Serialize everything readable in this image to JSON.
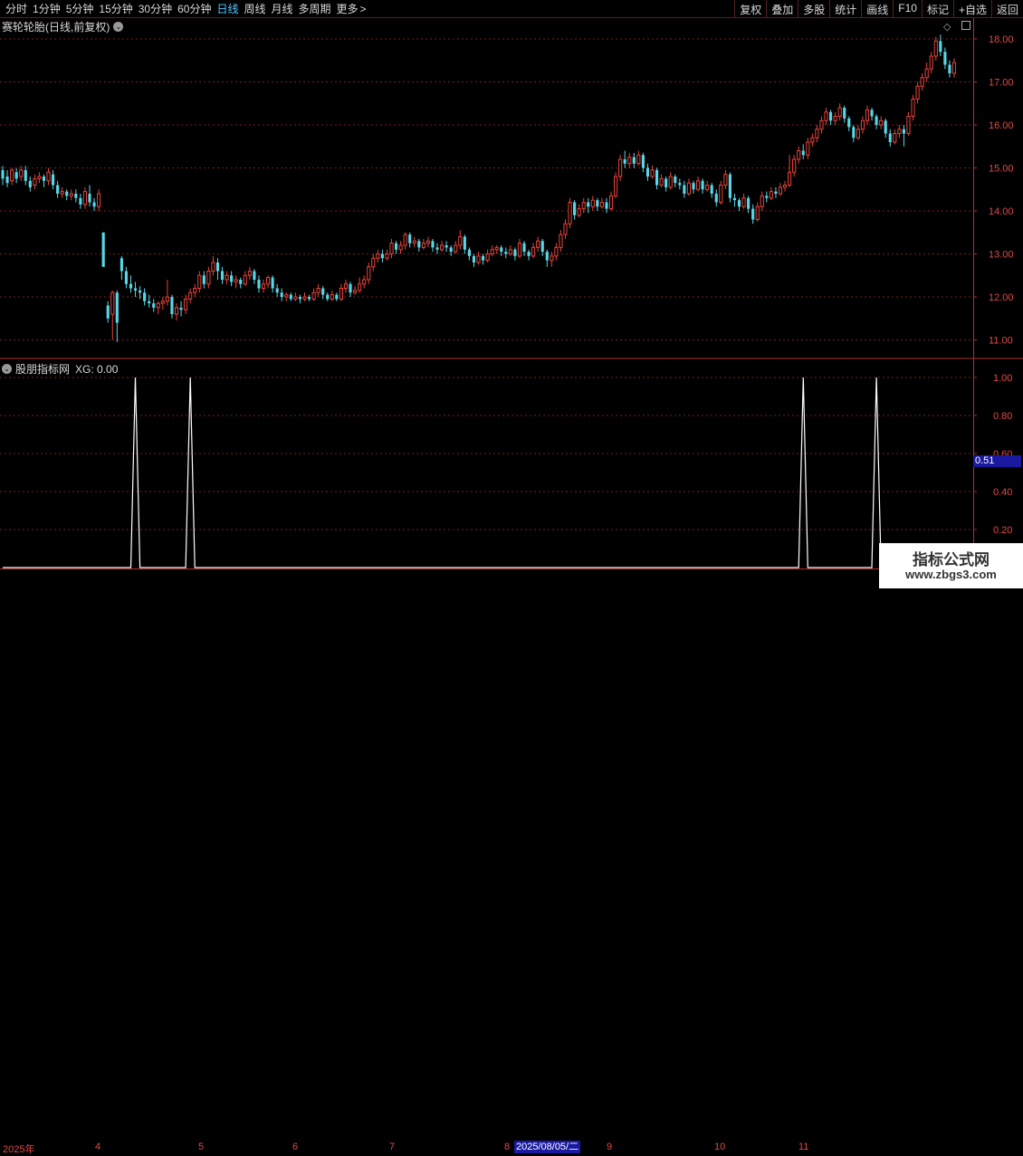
{
  "toolbar": {
    "periods": [
      "分时",
      "1分钟",
      "5分钟",
      "15分钟",
      "30分钟",
      "60分钟",
      "日线",
      "周线",
      "月线",
      "多周期",
      "更多"
    ],
    "active_period": "日线",
    "more_arrow": ">",
    "right_buttons": [
      "复权",
      "叠加",
      "多股",
      "统计",
      "画线",
      "F10",
      "+自选",
      "返回"
    ],
    "right_extra": "标记"
  },
  "main_chart": {
    "title": "赛轮轮胎(日线,前复权)",
    "price_ticks": [
      "18.00",
      "17.00",
      "16.00",
      "15.00",
      "14.00",
      "13.00",
      "12.00",
      "11.00"
    ]
  },
  "indicator": {
    "title": "股朋指标网",
    "value_label": "XG: 0.00",
    "ticks": [
      "1.00",
      "0.80",
      "0.60",
      "0.40",
      "0.20"
    ],
    "cursor_value": "0.51"
  },
  "date_axis": {
    "labels": [
      "2025年",
      "4",
      "5",
      "6",
      "7",
      "8",
      "9",
      "10",
      "11"
    ],
    "cursor_date": "2025/08/05/二"
  },
  "watermark": {
    "line1": "指标公式网",
    "line2": "www.zbgs3.com"
  },
  "colors": {
    "up": "#e8433c",
    "down": "#56d8e8",
    "grid": "#7a1c1c",
    "axis": "#b03030",
    "signal": "#ffffff"
  },
  "chart_data": {
    "type": "candlestick",
    "title": "赛轮轮胎(日线,前复权)",
    "price_range": [
      10.7,
      18.3
    ],
    "indicator_series": {
      "name": "XG",
      "signal_days": [
        29,
        41,
        175,
        191
      ],
      "values_range": [
        0,
        1
      ]
    },
    "candles": [
      [
        14.95,
        14.75,
        15.05,
        14.6
      ],
      [
        14.8,
        14.65,
        14.95,
        14.55
      ],
      [
        14.7,
        14.95,
        15.0,
        14.6
      ],
      [
        14.9,
        14.75,
        15.0,
        14.65
      ],
      [
        14.8,
        14.95,
        15.05,
        14.7
      ],
      [
        14.95,
        14.7,
        15.05,
        14.6
      ],
      [
        14.7,
        14.55,
        14.8,
        14.45
      ],
      [
        14.6,
        14.75,
        14.85,
        14.5
      ],
      [
        14.75,
        14.8,
        14.9,
        14.65
      ],
      [
        14.8,
        14.7,
        14.85,
        14.55
      ],
      [
        14.7,
        14.9,
        15.0,
        14.6
      ],
      [
        14.85,
        14.6,
        14.95,
        14.5
      ],
      [
        14.6,
        14.4,
        14.7,
        14.3
      ],
      [
        14.4,
        14.45,
        14.55,
        14.3
      ],
      [
        14.45,
        14.35,
        14.5,
        14.25
      ],
      [
        14.35,
        14.4,
        14.5,
        14.25
      ],
      [
        14.4,
        14.3,
        14.5,
        14.2
      ],
      [
        14.3,
        14.15,
        14.4,
        14.05
      ],
      [
        14.15,
        14.45,
        14.55,
        14.05
      ],
      [
        14.4,
        14.2,
        14.6,
        14.1
      ],
      [
        14.2,
        14.1,
        14.3,
        14.0
      ],
      [
        14.1,
        14.4,
        14.5,
        14.0
      ],
      [
        13.5,
        12.7,
        13.5,
        12.7
      ],
      [
        11.8,
        11.5,
        11.9,
        11.4
      ],
      [
        11.6,
        12.1,
        12.15,
        11.0
      ],
      [
        12.1,
        11.4,
        12.15,
        10.95
      ],
      [
        12.9,
        12.6,
        12.95,
        12.4
      ],
      [
        12.6,
        12.3,
        12.7,
        12.2
      ],
      [
        12.3,
        12.2,
        12.5,
        12.1
      ],
      [
        12.2,
        12.15,
        12.35,
        12.0
      ],
      [
        12.15,
        12.1,
        12.25,
        11.95
      ],
      [
        12.1,
        11.9,
        12.2,
        11.8
      ],
      [
        11.9,
        11.85,
        12.05,
        11.75
      ],
      [
        11.85,
        11.75,
        11.95,
        11.65
      ],
      [
        11.75,
        11.85,
        11.9,
        11.6
      ],
      [
        11.85,
        11.9,
        12.0,
        11.7
      ],
      [
        11.9,
        12.0,
        12.4,
        11.8
      ],
      [
        12.0,
        11.6,
        12.05,
        11.5
      ],
      [
        11.6,
        11.75,
        11.85,
        11.45
      ],
      [
        11.75,
        11.7,
        11.9,
        11.55
      ],
      [
        11.7,
        11.95,
        12.05,
        11.6
      ],
      [
        11.95,
        12.1,
        12.2,
        11.85
      ],
      [
        12.1,
        12.2,
        12.3,
        12.0
      ],
      [
        12.2,
        12.5,
        12.6,
        12.1
      ],
      [
        12.5,
        12.3,
        12.6,
        12.2
      ],
      [
        12.3,
        12.6,
        12.7,
        12.2
      ],
      [
        12.6,
        12.8,
        12.95,
        12.5
      ],
      [
        12.8,
        12.6,
        12.9,
        12.4
      ],
      [
        12.6,
        12.4,
        12.7,
        12.3
      ],
      [
        12.4,
        12.5,
        12.6,
        12.3
      ],
      [
        12.5,
        12.35,
        12.6,
        12.25
      ],
      [
        12.35,
        12.4,
        12.5,
        12.2
      ],
      [
        12.4,
        12.3,
        12.45,
        12.2
      ],
      [
        12.3,
        12.5,
        12.6,
        12.25
      ],
      [
        12.5,
        12.6,
        12.7,
        12.4
      ],
      [
        12.6,
        12.4,
        12.65,
        12.3
      ],
      [
        12.4,
        12.2,
        12.5,
        12.1
      ],
      [
        12.2,
        12.3,
        12.4,
        12.1
      ],
      [
        12.3,
        12.45,
        12.5,
        12.2
      ],
      [
        12.45,
        12.2,
        12.5,
        12.1
      ],
      [
        12.2,
        12.1,
        12.3,
        12.0
      ],
      [
        12.1,
        12.0,
        12.2,
        11.9
      ],
      [
        12.0,
        12.05,
        12.1,
        11.9
      ],
      [
        12.05,
        11.95,
        12.1,
        11.9
      ],
      [
        11.95,
        12.0,
        12.1,
        11.9
      ],
      [
        12.0,
        11.95,
        12.05,
        11.85
      ],
      [
        11.95,
        12.0,
        12.1,
        11.9
      ],
      [
        12.0,
        11.95,
        12.05,
        11.9
      ],
      [
        11.95,
        12.1,
        12.2,
        11.9
      ],
      [
        12.1,
        12.2,
        12.3,
        12.0
      ],
      [
        12.2,
        12.05,
        12.25,
        11.95
      ],
      [
        12.05,
        11.95,
        12.1,
        11.9
      ],
      [
        11.95,
        12.05,
        12.15,
        11.9
      ],
      [
        12.05,
        11.95,
        12.1,
        11.9
      ],
      [
        11.95,
        12.2,
        12.3,
        11.9
      ],
      [
        12.2,
        12.3,
        12.4,
        12.1
      ],
      [
        12.3,
        12.1,
        12.35,
        12.0
      ],
      [
        12.1,
        12.15,
        12.25,
        12.05
      ],
      [
        12.15,
        12.3,
        12.45,
        12.1
      ],
      [
        12.3,
        12.4,
        12.5,
        12.2
      ],
      [
        12.4,
        12.7,
        12.8,
        12.3
      ],
      [
        12.7,
        12.9,
        13.0,
        12.6
      ],
      [
        12.9,
        13.0,
        13.1,
        12.8
      ],
      [
        13.0,
        12.9,
        13.1,
        12.8
      ],
      [
        12.9,
        13.0,
        13.1,
        12.85
      ],
      [
        13.0,
        13.25,
        13.35,
        12.9
      ],
      [
        13.25,
        13.1,
        13.3,
        13.0
      ],
      [
        13.1,
        13.2,
        13.3,
        13.0
      ],
      [
        13.2,
        13.45,
        13.5,
        13.1
      ],
      [
        13.45,
        13.25,
        13.5,
        13.15
      ],
      [
        13.25,
        13.3,
        13.4,
        13.15
      ],
      [
        13.3,
        13.15,
        13.35,
        13.05
      ],
      [
        13.15,
        13.25,
        13.35,
        13.1
      ],
      [
        13.25,
        13.3,
        13.4,
        13.15
      ],
      [
        13.3,
        13.15,
        13.35,
        13.05
      ],
      [
        13.15,
        13.1,
        13.25,
        13.0
      ],
      [
        13.1,
        13.2,
        13.3,
        13.05
      ],
      [
        13.2,
        13.15,
        13.3,
        13.05
      ],
      [
        13.15,
        13.05,
        13.2,
        12.95
      ],
      [
        13.05,
        13.2,
        13.3,
        13.0
      ],
      [
        13.2,
        13.4,
        13.55,
        13.1
      ],
      [
        13.4,
        13.1,
        13.45,
        13.0
      ],
      [
        13.1,
        12.95,
        13.15,
        12.85
      ],
      [
        12.95,
        12.8,
        13.0,
        12.7
      ],
      [
        12.8,
        12.95,
        13.05,
        12.75
      ],
      [
        12.95,
        12.85,
        13.0,
        12.75
      ],
      [
        12.85,
        13.0,
        13.1,
        12.8
      ],
      [
        13.0,
        13.1,
        13.2,
        12.95
      ],
      [
        13.1,
        13.15,
        13.2,
        13.0
      ],
      [
        13.15,
        13.05,
        13.2,
        12.95
      ],
      [
        13.05,
        13.0,
        13.15,
        12.9
      ],
      [
        13.0,
        13.1,
        13.2,
        12.95
      ],
      [
        13.1,
        12.95,
        13.15,
        12.85
      ],
      [
        12.95,
        13.25,
        13.35,
        12.9
      ],
      [
        13.25,
        13.05,
        13.3,
        12.95
      ],
      [
        13.05,
        12.95,
        13.1,
        12.85
      ],
      [
        12.95,
        13.15,
        13.25,
        12.9
      ],
      [
        13.15,
        13.3,
        13.4,
        13.05
      ],
      [
        13.3,
        13.05,
        13.35,
        12.95
      ],
      [
        13.05,
        12.85,
        13.1,
        12.7
      ],
      [
        12.85,
        12.95,
        13.05,
        12.7
      ],
      [
        12.95,
        13.15,
        13.25,
        12.85
      ],
      [
        13.15,
        13.45,
        13.55,
        13.05
      ],
      [
        13.45,
        13.7,
        13.8,
        13.35
      ],
      [
        13.7,
        14.2,
        14.3,
        13.6
      ],
      [
        14.2,
        13.9,
        14.25,
        13.8
      ],
      [
        13.9,
        14.05,
        14.15,
        13.85
      ],
      [
        14.05,
        14.2,
        14.3,
        13.95
      ],
      [
        14.2,
        14.1,
        14.3,
        13.95
      ],
      [
        14.1,
        14.25,
        14.35,
        14.0
      ],
      [
        14.25,
        14.1,
        14.3,
        14.0
      ],
      [
        14.1,
        14.2,
        14.3,
        14.05
      ],
      [
        14.2,
        14.05,
        14.3,
        13.95
      ],
      [
        14.05,
        14.35,
        14.45,
        14.0
      ],
      [
        14.35,
        14.8,
        14.9,
        14.3
      ],
      [
        14.8,
        15.2,
        15.3,
        14.7
      ],
      [
        15.2,
        15.1,
        15.4,
        15.0
      ],
      [
        15.1,
        15.25,
        15.35,
        15.0
      ],
      [
        15.25,
        15.1,
        15.35,
        15.0
      ],
      [
        15.1,
        15.3,
        15.4,
        15.05
      ],
      [
        15.3,
        15.0,
        15.35,
        14.9
      ],
      [
        15.0,
        14.8,
        15.1,
        14.7
      ],
      [
        14.8,
        14.95,
        15.05,
        14.75
      ],
      [
        14.95,
        14.6,
        15.0,
        14.5
      ],
      [
        14.6,
        14.75,
        14.85,
        14.55
      ],
      [
        14.75,
        14.55,
        14.8,
        14.45
      ],
      [
        14.55,
        14.8,
        14.9,
        14.5
      ],
      [
        14.8,
        14.65,
        14.85,
        14.55
      ],
      [
        14.65,
        14.6,
        14.75,
        14.5
      ],
      [
        14.6,
        14.4,
        14.7,
        14.3
      ],
      [
        14.4,
        14.65,
        14.75,
        14.35
      ],
      [
        14.65,
        14.5,
        14.7,
        14.4
      ],
      [
        14.5,
        14.7,
        14.8,
        14.45
      ],
      [
        14.7,
        14.5,
        14.75,
        14.4
      ],
      [
        14.5,
        14.6,
        14.7,
        14.45
      ],
      [
        14.6,
        14.4,
        14.65,
        14.3
      ],
      [
        14.4,
        14.2,
        14.5,
        14.1
      ],
      [
        14.2,
        14.6,
        14.7,
        14.15
      ],
      [
        14.6,
        14.85,
        14.95,
        14.5
      ],
      [
        14.85,
        14.3,
        14.9,
        14.2
      ],
      [
        14.3,
        14.25,
        14.4,
        14.1
      ],
      [
        14.25,
        14.1,
        14.3,
        14.0
      ],
      [
        14.1,
        14.3,
        14.4,
        14.05
      ],
      [
        14.3,
        14.05,
        14.35,
        13.95
      ],
      [
        14.05,
        13.8,
        14.15,
        13.7
      ],
      [
        13.8,
        14.1,
        14.2,
        13.75
      ],
      [
        14.1,
        14.35,
        14.45,
        14.0
      ],
      [
        14.35,
        14.3,
        14.45,
        14.2
      ],
      [
        14.3,
        14.45,
        14.55,
        14.25
      ],
      [
        14.45,
        14.4,
        14.55,
        14.3
      ],
      [
        14.4,
        14.55,
        14.65,
        14.35
      ],
      [
        14.55,
        14.6,
        14.7,
        14.45
      ],
      [
        14.6,
        14.9,
        15.3,
        14.55
      ],
      [
        14.9,
        15.2,
        15.3,
        14.8
      ],
      [
        15.2,
        15.4,
        15.5,
        15.1
      ],
      [
        15.4,
        15.3,
        15.55,
        15.2
      ],
      [
        15.3,
        15.6,
        15.7,
        15.2
      ],
      [
        15.6,
        15.7,
        15.8,
        15.5
      ],
      [
        15.7,
        15.9,
        16.0,
        15.6
      ],
      [
        15.9,
        16.1,
        16.2,
        15.8
      ],
      [
        16.1,
        16.3,
        16.4,
        16.0
      ],
      [
        16.3,
        16.1,
        16.35,
        16.0
      ],
      [
        16.1,
        16.2,
        16.3,
        16.0
      ],
      [
        16.2,
        16.4,
        16.5,
        16.1
      ],
      [
        16.4,
        16.15,
        16.45,
        16.05
      ],
      [
        16.15,
        15.95,
        16.2,
        15.85
      ],
      [
        15.95,
        15.7,
        16.0,
        15.6
      ],
      [
        15.7,
        15.9,
        16.0,
        15.65
      ],
      [
        15.9,
        16.1,
        16.2,
        15.8
      ],
      [
        16.1,
        16.35,
        16.45,
        16.0
      ],
      [
        16.35,
        16.2,
        16.4,
        16.1
      ],
      [
        16.2,
        16.0,
        16.25,
        15.9
      ],
      [
        16.0,
        16.1,
        16.2,
        15.9
      ],
      [
        16.1,
        15.8,
        16.15,
        15.7
      ],
      [
        15.8,
        15.6,
        15.9,
        15.5
      ],
      [
        15.6,
        15.8,
        15.9,
        15.55
      ],
      [
        15.8,
        15.9,
        16.0,
        15.7
      ],
      [
        15.9,
        15.8,
        16.0,
        15.5
      ],
      [
        15.8,
        16.2,
        16.3,
        15.75
      ],
      [
        16.2,
        16.6,
        16.7,
        16.1
      ],
      [
        16.6,
        16.9,
        17.0,
        16.5
      ],
      [
        16.9,
        17.1,
        17.2,
        16.8
      ],
      [
        17.1,
        17.3,
        17.45,
        17.0
      ],
      [
        17.3,
        17.6,
        17.7,
        17.2
      ],
      [
        17.6,
        17.95,
        18.05,
        17.5
      ],
      [
        17.95,
        17.7,
        18.1,
        17.6
      ],
      [
        17.7,
        17.4,
        17.8,
        17.3
      ],
      [
        17.4,
        17.2,
        17.5,
        17.1
      ],
      [
        17.2,
        17.45,
        17.55,
        17.1
      ]
    ]
  }
}
